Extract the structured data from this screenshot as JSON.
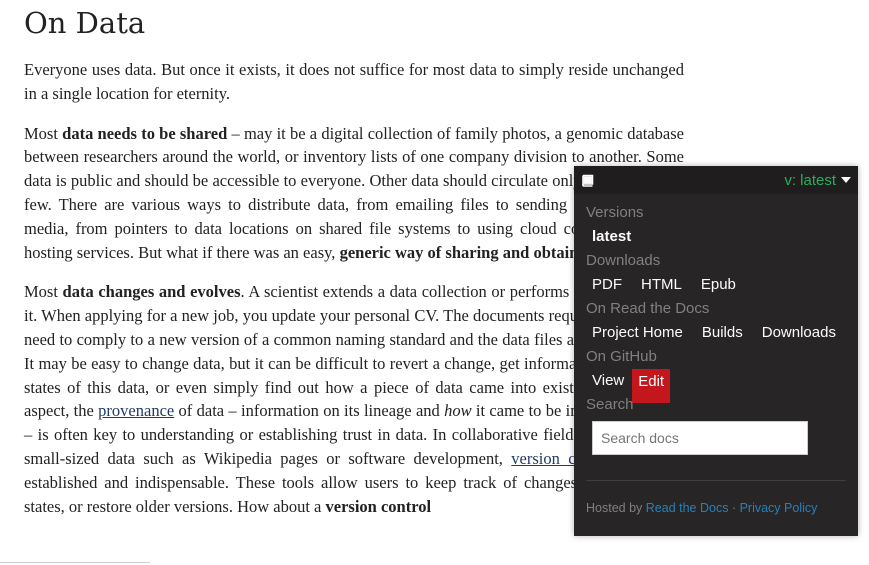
{
  "doc": {
    "title": "On Data",
    "p1": "Everyone uses data. But once it exists, it does not suffice for most data to simply reside unchanged in a single location for eternity.",
    "p2_pre": "Most ",
    "p2_bold1": "data needs to be shared",
    "p2_mid": " – may it be a digital collection of family photos, a genomic database between researchers around the world, or inventory lists of one company division to another. Some data is public and should be accessible to everyone. Other data should circulate only among a select few. There are various ways to distribute data, from emailing files to sending physical storage media, from pointers to data locations on shared file systems to using cloud computing or file hosting services. But what if there was an easy, ",
    "p2_bold2": "generic way of sharing and obtaining data",
    "p2_end": "?",
    "p3_pre": "Most ",
    "p3_bold1": "data changes and evolves",
    "p3_a": ". A scientist extends a data collection or performs computations on it. When applying for a new job, you update your personal CV. The documents required for an audit need to comply to a new version of a common naming standard and the data files are thus renamed. It may be easy to change data, but it can be difficult to revert a change, get information on previous states of this data, or even simply find out how a piece of data came into existence. This latter aspect, the ",
    "p3_link1": "provenance",
    "p3_b": " of data – information on its lineage and ",
    "p3_italic": "how",
    "p3_c": " it came to be in its current state – is often key to understanding or establishing trust in data. In collaborative fields that work with small-sized data such as Wikipedia pages or software development, ",
    "p3_link2": "version control",
    "p3_d": " tools are established and indispensable. These tools allow users to keep track of changes, view previous states, or restore older versions. How about a ",
    "p3_bold2": "version control"
  },
  "rtd": {
    "version_label": "v: latest",
    "versions_title": "Versions",
    "version_latest": "latest",
    "downloads_title": "Downloads",
    "downloads": [
      "PDF",
      "HTML",
      "Epub"
    ],
    "rtd_title": "On Read the Docs",
    "rtd_links": [
      "Project Home",
      "Builds",
      "Downloads"
    ],
    "github_title": "On GitHub",
    "github_view": "View",
    "github_edit": "Edit",
    "search_title": "Search",
    "search_placeholder": "Search docs",
    "hosted_by": "Hosted by ",
    "hosted_link": "Read the Docs",
    "sep": " · ",
    "privacy": "Privacy Policy",
    "accent_green": "#27ae60",
    "edit_red": "#c4171d"
  }
}
